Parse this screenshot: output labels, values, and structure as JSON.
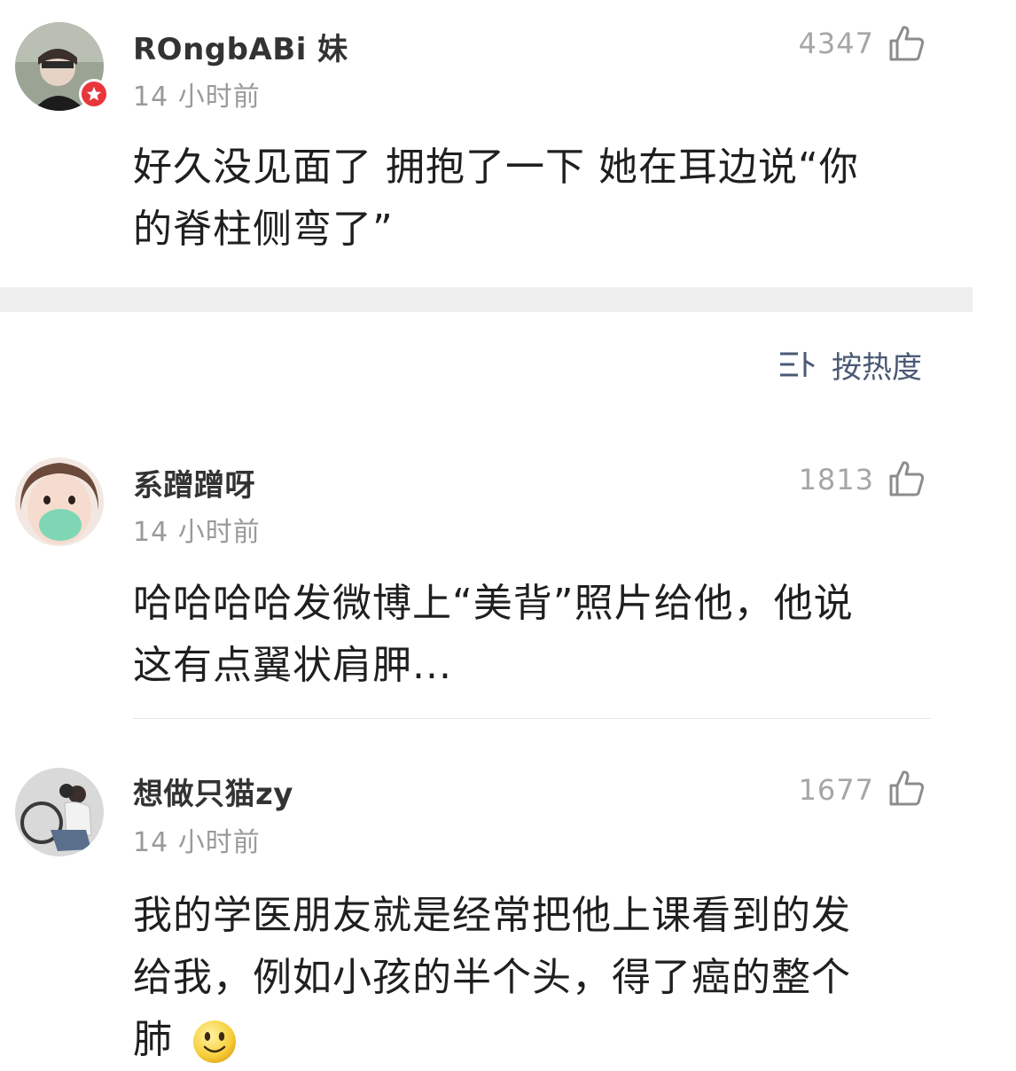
{
  "comments": [
    {
      "username": "ROngbABi 妹",
      "time": "14 小时前",
      "likes": "4347",
      "text_lines": [
        "好久没见面了 拥抱了一下 她在耳边说“你",
        "的脊柱侧弯了”"
      ],
      "verified": true
    },
    {
      "username": "系蹭蹭呀",
      "time": "14 小时前",
      "likes": "1813",
      "text_lines": [
        "哈哈哈哈发微博上“美背”照片给他，他说",
        "这有点翼状肩胛..."
      ]
    },
    {
      "username": "想做只猫zy",
      "time": "14 小时前",
      "likes": "1677",
      "text_lines": [
        "我的学医朋友就是经常把他上课看到的发",
        "给我，例如小孩的半个头，得了癌的整个",
        "肺"
      ],
      "emoji": "smile-emoji"
    }
  ],
  "sort": {
    "label": "按热度",
    "icon": "sort-icon"
  },
  "colors": {
    "verified_badge": "#e8363b",
    "sort_text": "#4a5a75",
    "likes_text": "#a6a6a6",
    "time_text": "#9a9a9a",
    "section_band": "#efefef"
  }
}
